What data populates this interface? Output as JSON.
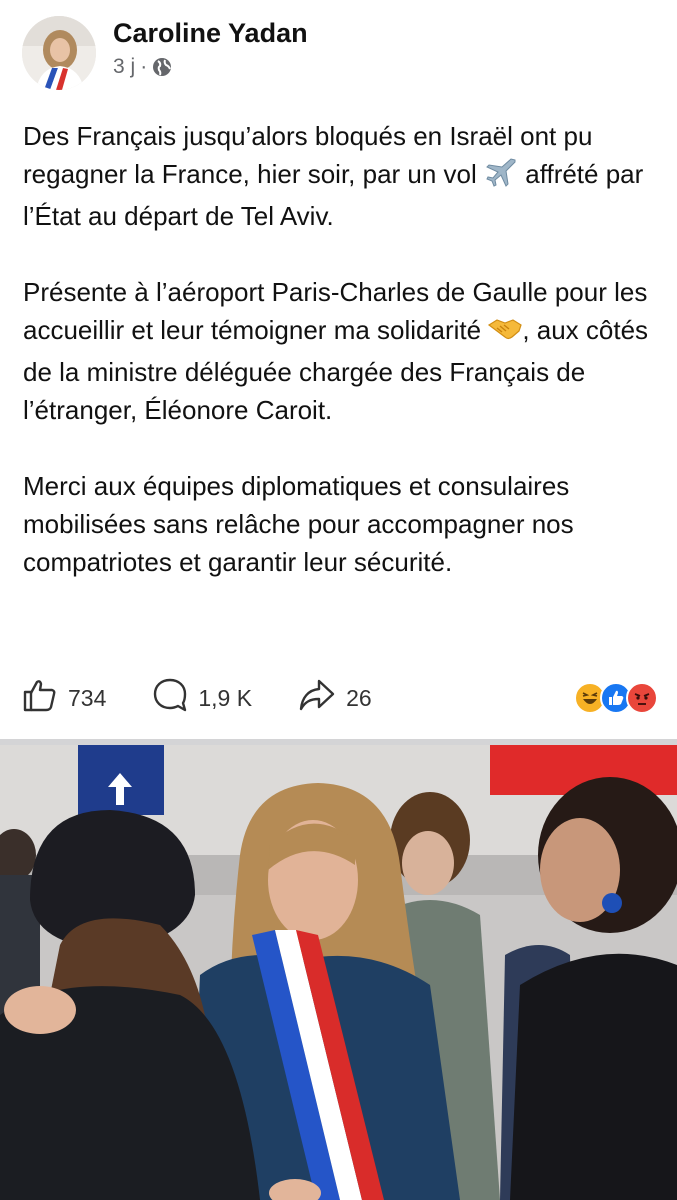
{
  "post": {
    "author": "Caroline Yadan",
    "time": "3 j",
    "separator": "·",
    "privacy_icon": "globe-icon",
    "paragraphs": [
      {
        "text_before": "Des Français jusqu’alors bloqués en Israël ont pu regagner la France, hier soir, par un vol ",
        "emoji": "airplane-emoji",
        "text_after": " affrété par l’État au départ de Tel Aviv."
      },
      {
        "text_before": "Présente à l’aéroport Paris-Charles de Gaulle pour les accueillir et leur témoigner ma solidarité ",
        "emoji": "handshake-emoji",
        "text_after": ", aux côtés de la ministre déléguée chargée des Français de l’étranger, Éléonore Caroit."
      },
      {
        "text": "Merci aux équipes diplomatiques et consulaires mobilisées sans relâche pour accompagner nos compatriotes et garantir leur sécurité."
      }
    ]
  },
  "actions": {
    "likes": "734",
    "comments": "1,9 K",
    "shares": "26",
    "reactions": [
      "haha-emoji",
      "like-emoji",
      "angry-emoji"
    ]
  },
  "colors": {
    "like_blue": "#1877f2",
    "angry_red": "#e9463b",
    "haha_yellow": "#f7b125",
    "meta_gray": "#65676b"
  }
}
